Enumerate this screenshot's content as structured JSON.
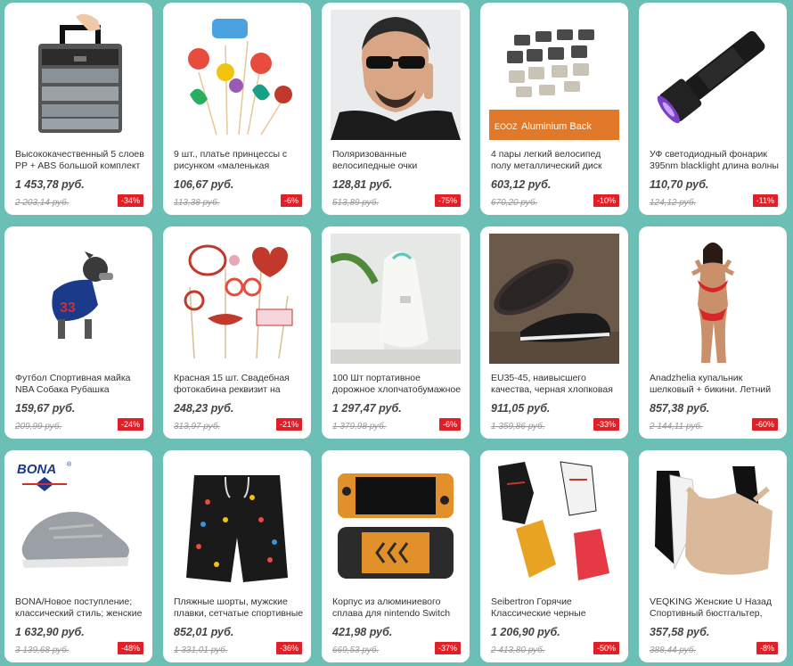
{
  "products": [
    {
      "title": "Высококачественный 5 слоев PP + ABS большой комплект",
      "price": "1 453,78 руб.",
      "old_price": "2 203,14 руб.",
      "discount": "-34%",
      "image": "tackle-box-icon"
    },
    {
      "title": "9 шт., платье принцессы с рисунком «маленькая",
      "price": "106,67 руб.",
      "old_price": "113,38 руб.",
      "discount": "-6%",
      "image": "mermaid-toppers-icon"
    },
    {
      "title": "Поляризованные велосипедные очки велосипед",
      "price": "128,81 руб.",
      "old_price": "513,89 руб.",
      "discount": "-75%",
      "image": "sunglasses-man-icon"
    },
    {
      "title": "4 пары легкий велосипед полу металлический диск",
      "price": "603,12 руб.",
      "old_price": "670,20 руб.",
      "discount": "-10%",
      "image": "brake-pads-icon",
      "image_text": [
        "EOOZ",
        "Aluminium Back"
      ]
    },
    {
      "title": "УФ светодиодный фонарик 395nm blacklight длина волны",
      "price": "110,70 руб.",
      "old_price": "124,12 руб.",
      "discount": "-11%",
      "image": "uv-flashlight-icon"
    },
    {
      "title": "Футбол Спортивная майка NBA Собака Рубашка дешевая",
      "price": "159,67 руб.",
      "old_price": "209,99 руб.",
      "discount": "-24%",
      "image": "dog-jersey-icon"
    },
    {
      "title": "Красная 15 шт. Свадебная фотокабина реквизит на",
      "price": "248,23 руб.",
      "old_price": "313,97 руб.",
      "discount": "-21%",
      "image": "photo-props-icon"
    },
    {
      "title": "100 Шт портативное дорожное хлопчатобумажное",
      "price": "1 297,47 руб.",
      "old_price": "1 379,98 руб.",
      "discount": "-6%",
      "image": "cotton-bag-icon"
    },
    {
      "title": "EU35-45, наивысшего качества, черная хлопковая",
      "price": "911,05 руб.",
      "old_price": "1 359,86 руб.",
      "discount": "-33%",
      "image": "cloth-shoes-icon"
    },
    {
      "title": "Anadzhelia купальник шелковый + бикини. Летний",
      "price": "857,38 руб.",
      "old_price": "2 144,11 руб.",
      "discount": "-60%",
      "image": "bikini-model-icon"
    },
    {
      "title": "BONA/Новое поступление; классический стиль; женские",
      "price": "1 632,90 руб.",
      "old_price": "3 139,68 руб.",
      "discount": "-48%",
      "image": "sneaker-icon",
      "image_text": [
        "BONA",
        "®"
      ]
    },
    {
      "title": "Пляжные шорты, мужские плавки, сетчатые спортивные",
      "price": "852,01 руб.",
      "old_price": "1 331,01 руб.",
      "discount": "-36%",
      "image": "swim-shorts-icon"
    },
    {
      "title": "Корпус из алюминиевого сплава для nintendo Switch",
      "price": "421,98 руб.",
      "old_price": "669,53 руб.",
      "discount": "-37%",
      "image": "switch-case-icon"
    },
    {
      "title": "Seibertron Горячие Классические черные",
      "price": "1 206,90 руб.",
      "old_price": "2 413,80 руб.",
      "discount": "-50%",
      "image": "gloves-icon"
    },
    {
      "title": "VEQKING Женские U Назад Спортивный бюстгальтер,",
      "price": "357,58 руб.",
      "old_price": "388,44 руб.",
      "discount": "-8%",
      "image": "sports-bra-icon"
    }
  ],
  "colors": {
    "background": "#6bbfb4",
    "badge": "#e21f26",
    "card": "#ffffff"
  }
}
